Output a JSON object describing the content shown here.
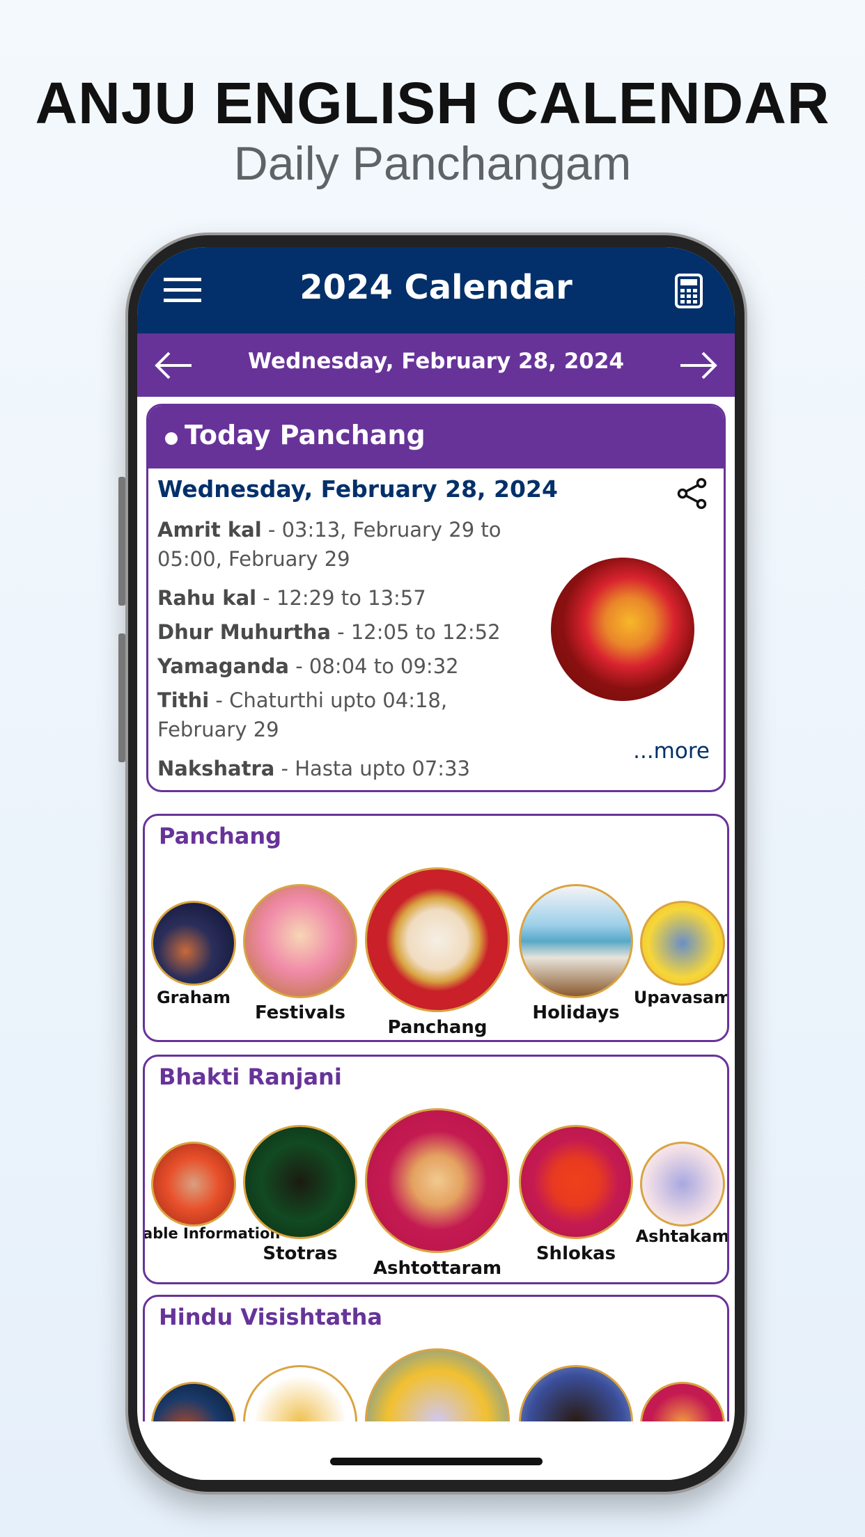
{
  "promo": {
    "title": "ANJU ENGLISH CALENDAR",
    "subtitle": "Daily Panchangam"
  },
  "header": {
    "title": "2024 Calendar",
    "menu_icon": "hamburger-menu-icon",
    "right_icon": "calculator-icon"
  },
  "date_nav": {
    "date": "Wednesday, February 28, 2024",
    "prev_icon": "arrow-left-icon",
    "next_icon": "arrow-right-icon"
  },
  "today": {
    "heading": "Today Panchang",
    "date": "Wednesday, February 28, 2024",
    "share_icon": "share-icon",
    "rows": [
      {
        "label": "Amrit kal",
        "value": " - 03:13, February 29 to 05:00, February 29"
      },
      {
        "label": "Rahu kal",
        "value": " - 12:29 to 13:57"
      },
      {
        "label": "Dhur Muhurtha",
        "value": " - 12:05 to 12:52"
      },
      {
        "label": "Yamaganda",
        "value": " - 08:04 to 09:32"
      },
      {
        "label": "Tithi",
        "value": " - Chaturthi upto 04:18, February 29"
      },
      {
        "label": "Nakshatra",
        "value": " - Hasta upto 07:33"
      }
    ],
    "more": "...more"
  },
  "sections": [
    {
      "title": "Panchang",
      "items": [
        "Graham",
        "Festivals",
        "Panchang",
        "Holidays",
        "Upavasam"
      ]
    },
    {
      "title": "Bhakti Ranjani",
      "items": [
        "Valuable Information",
        "Stotras",
        "Ashtottaram",
        "Shlokas",
        "Ashtakam"
      ]
    },
    {
      "title": "Hindu Visishtatha",
      "items": []
    }
  ],
  "colors": {
    "navy": "#03306a",
    "purple": "#673399"
  }
}
